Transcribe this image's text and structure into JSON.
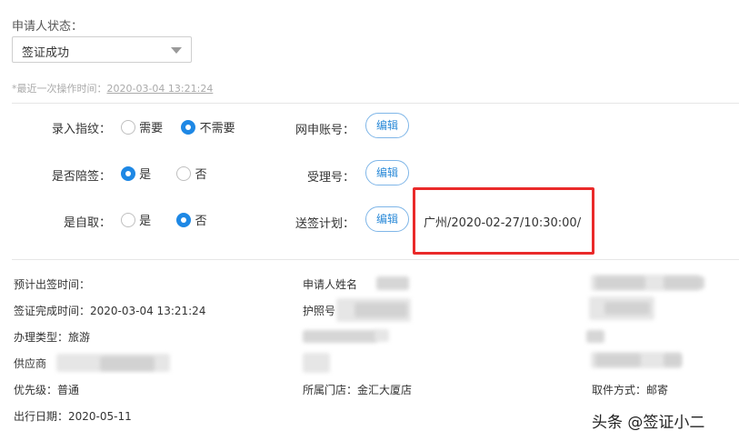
{
  "status": {
    "label": "申请人状态：",
    "selected": "签证成功"
  },
  "last_operation": {
    "prefix": "*最近一次操作时间：",
    "time": "2020-03-04 13:21:24"
  },
  "form": {
    "fingerprint": {
      "label": "录入指纹：",
      "options": [
        "需要",
        "不需要"
      ],
      "selected": "不需要"
    },
    "accompany": {
      "label": "是否陪签：",
      "options": [
        "是",
        "否"
      ],
      "selected": "是"
    },
    "self_pickup": {
      "label": "是自取：",
      "options": [
        "是",
        "否"
      ],
      "selected": "否"
    },
    "online_account": {
      "label": "网申账号：",
      "button": "编辑"
    },
    "receipt_no": {
      "label": "受理号：",
      "button": "编辑"
    },
    "send_plan": {
      "label": "送签计划：",
      "button": "编辑",
      "value": "广州/2020-02-27/10:30:00/"
    }
  },
  "info": {
    "expected_issue": "预计出签时间：",
    "visa_complete": "签证完成时间：2020-03-04 13:21:24",
    "type": "办理类型：旅游",
    "supplier": "供应商",
    "priority": "优先级：普通",
    "travel_date": "出行日期：2020-05-11",
    "applicant_name": "申请人姓名",
    "passport": "护照号",
    "store": "所属门店：金汇大厦店",
    "pickup_method": "取件方式：邮寄"
  },
  "watermark": "头条 @签证小二",
  "colors": {
    "accent": "#1e88e5",
    "highlight": "#ea2a2a"
  }
}
